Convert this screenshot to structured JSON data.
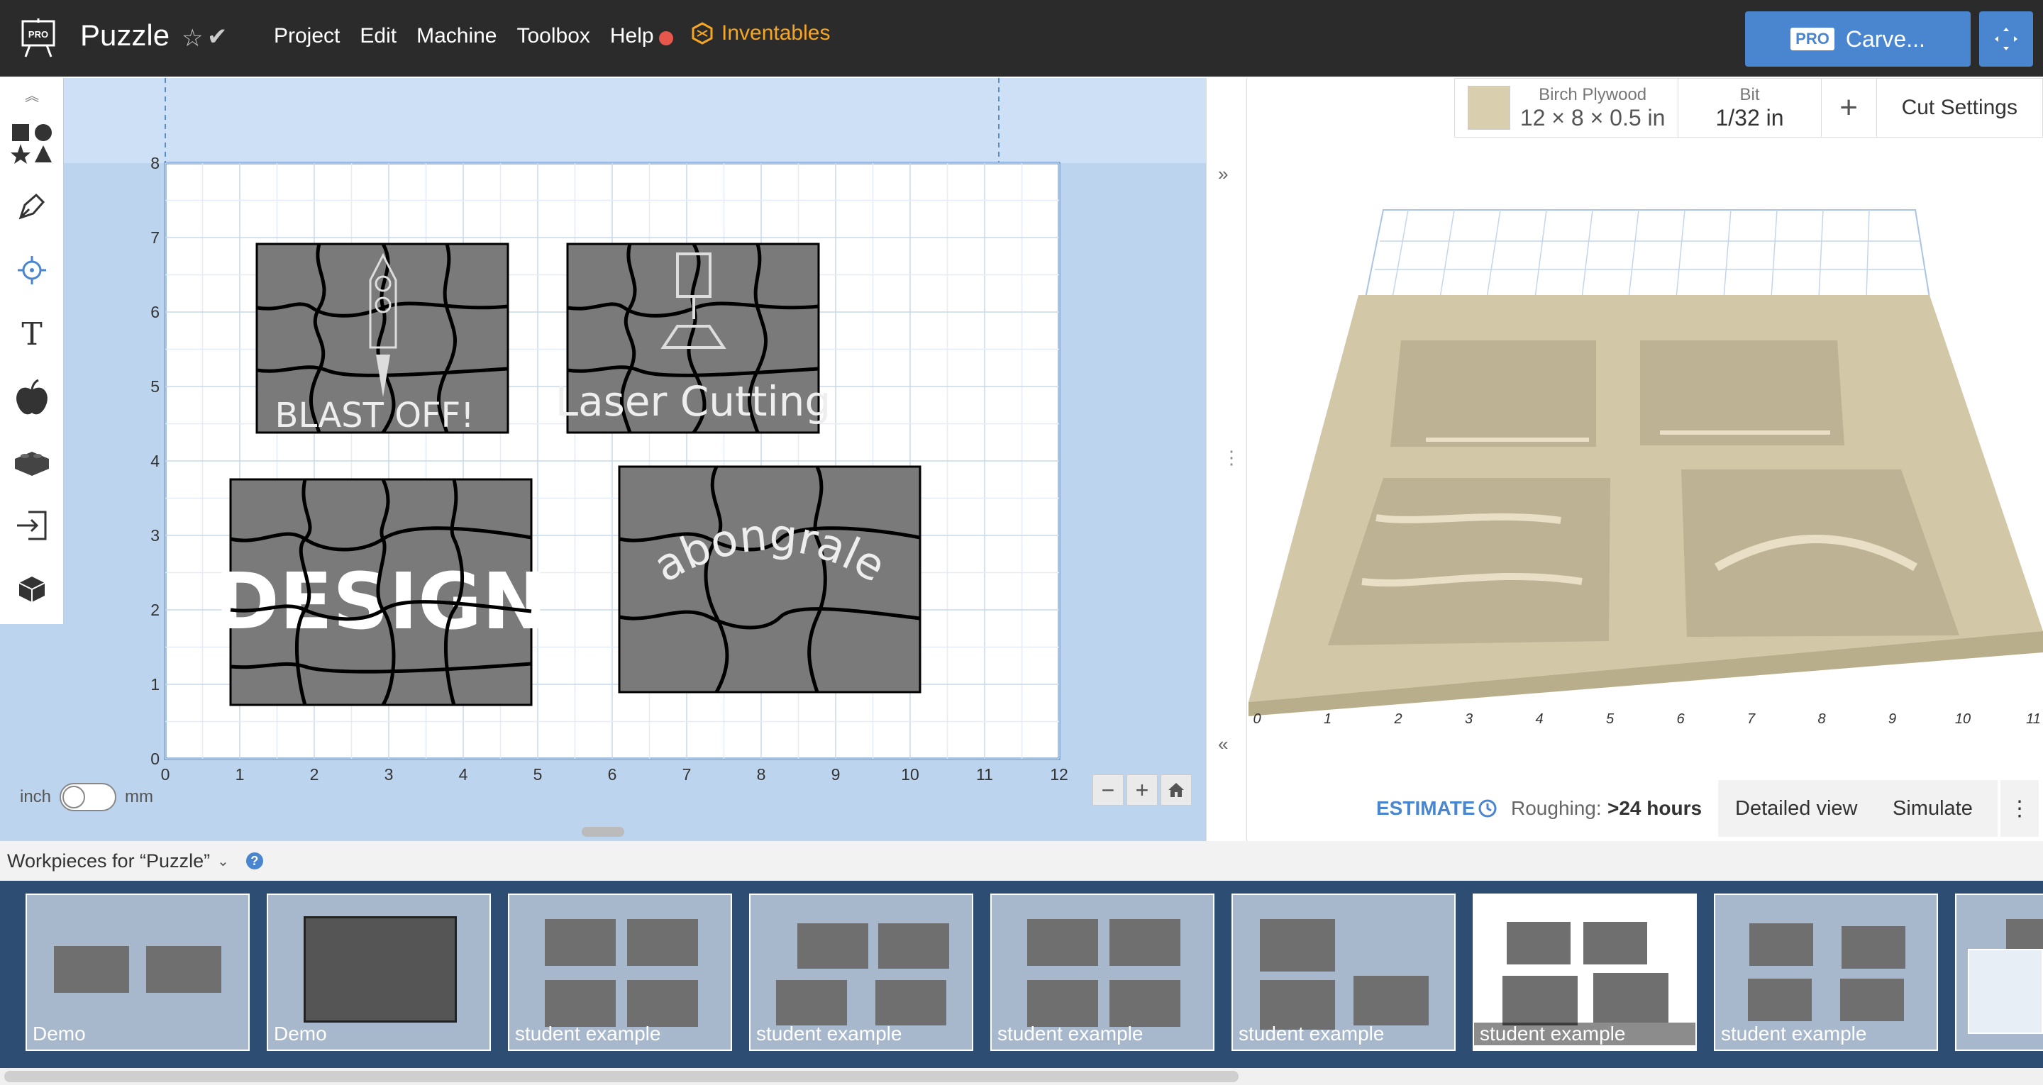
{
  "header": {
    "title": "Puzzle",
    "menu": [
      "Project",
      "Edit",
      "Machine",
      "Toolbox",
      "Help"
    ],
    "inventables": "Inventables",
    "carve_label": "Carve...",
    "pro": "PRO"
  },
  "canvas": {
    "x_ticks": [
      "0",
      "1",
      "2",
      "3",
      "4",
      "5",
      "6",
      "7",
      "8",
      "9",
      "10",
      "11",
      "12"
    ],
    "y_ticks": [
      "0",
      "1",
      "2",
      "3",
      "4",
      "5",
      "6",
      "7",
      "8"
    ],
    "unit_left": "inch",
    "unit_right": "mm",
    "texts": {
      "blast": "BLAST OFF!",
      "laser": "Laser Cutting",
      "design": "DESIGN",
      "ab": "abongrale"
    }
  },
  "material": {
    "name": "Birch Plywood",
    "size": "12 × 8 × 0.5 in",
    "bit_label": "Bit",
    "bit_value": "1/32 in",
    "cut_settings": "Cut Settings"
  },
  "preview_axis": [
    "0",
    "1",
    "2",
    "3",
    "4",
    "5",
    "6",
    "7",
    "8",
    "9",
    "10",
    "11"
  ],
  "estimate": {
    "label": "ESTIMATE",
    "roughing_label": "Roughing:",
    "roughing_value": ">24 hours",
    "detailed": "Detailed view",
    "simulate": "Simulate"
  },
  "workpieces": {
    "title": "Workpieces for “Puzzle”",
    "items": [
      "Demo",
      "Demo",
      "student example",
      "student example",
      "student example",
      "student example",
      "student example",
      "student example"
    ]
  }
}
